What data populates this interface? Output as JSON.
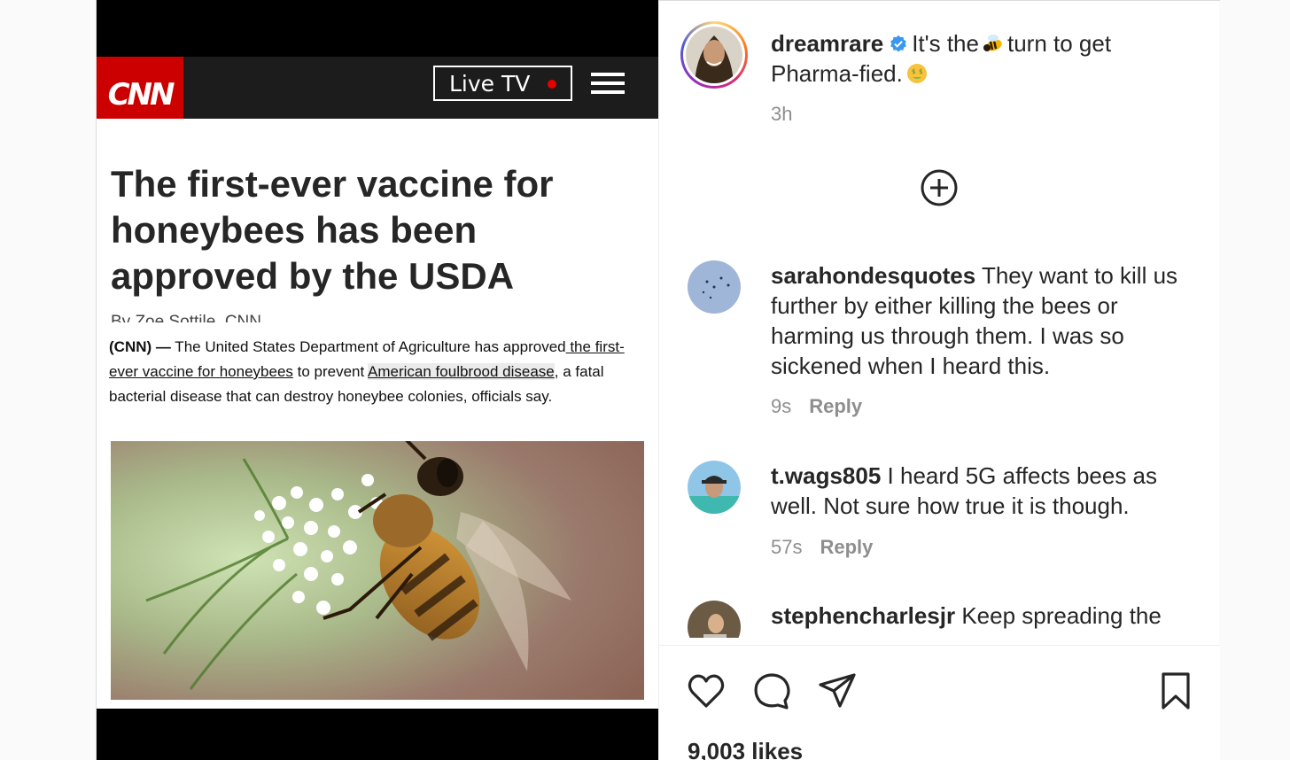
{
  "cnn": {
    "logo": "CNN",
    "live_tv": "Live TV",
    "headline": "The first-ever vaccine for honeybees has been approved by the USDA",
    "byline": "By Zoe Sottile, CNN",
    "body_lead": "(CNN) —",
    "body_1": " The United States Department of Agriculture has approved",
    "body_link_1": " the first-ever vaccine for honeybees",
    "body_2": " to prevent ",
    "body_link_2": "American foulbrood disease",
    "body_3": ", a fatal bacterial disease that can destroy honeybee colonies, officials say."
  },
  "post": {
    "author": "dreamrare",
    "caption_part1": "It's the",
    "caption_part2": "turn to get Pharma-fied.",
    "time": "3h",
    "icons": {
      "verified": "verified-badge-icon",
      "bee": "bee-emoji",
      "money_face": "money-mouth-face-emoji",
      "load_more": "plus-circle-icon"
    }
  },
  "comments": [
    {
      "username": "sarahondesquotes",
      "text": "They want to kill us further by either killing the bees or harming us through them. I was so sickened when I heard this.",
      "time": "9s",
      "reply": "Reply"
    },
    {
      "username": "t.wags805",
      "text": "I heard 5G affects bees as well. Not sure how true it is though.",
      "time": "57s",
      "reply": "Reply"
    },
    {
      "username": "stephencharlesjr",
      "text": "Keep spreading the"
    }
  ],
  "actions": {
    "icons": [
      "heart-icon",
      "comment-icon",
      "share-icon",
      "bookmark-icon"
    ],
    "likes": "9,003 likes"
  },
  "colors": {
    "cnn_red": "#cc0000",
    "verified_blue": "#3897f0",
    "text": "#262626",
    "muted": "#8e8e8e"
  }
}
